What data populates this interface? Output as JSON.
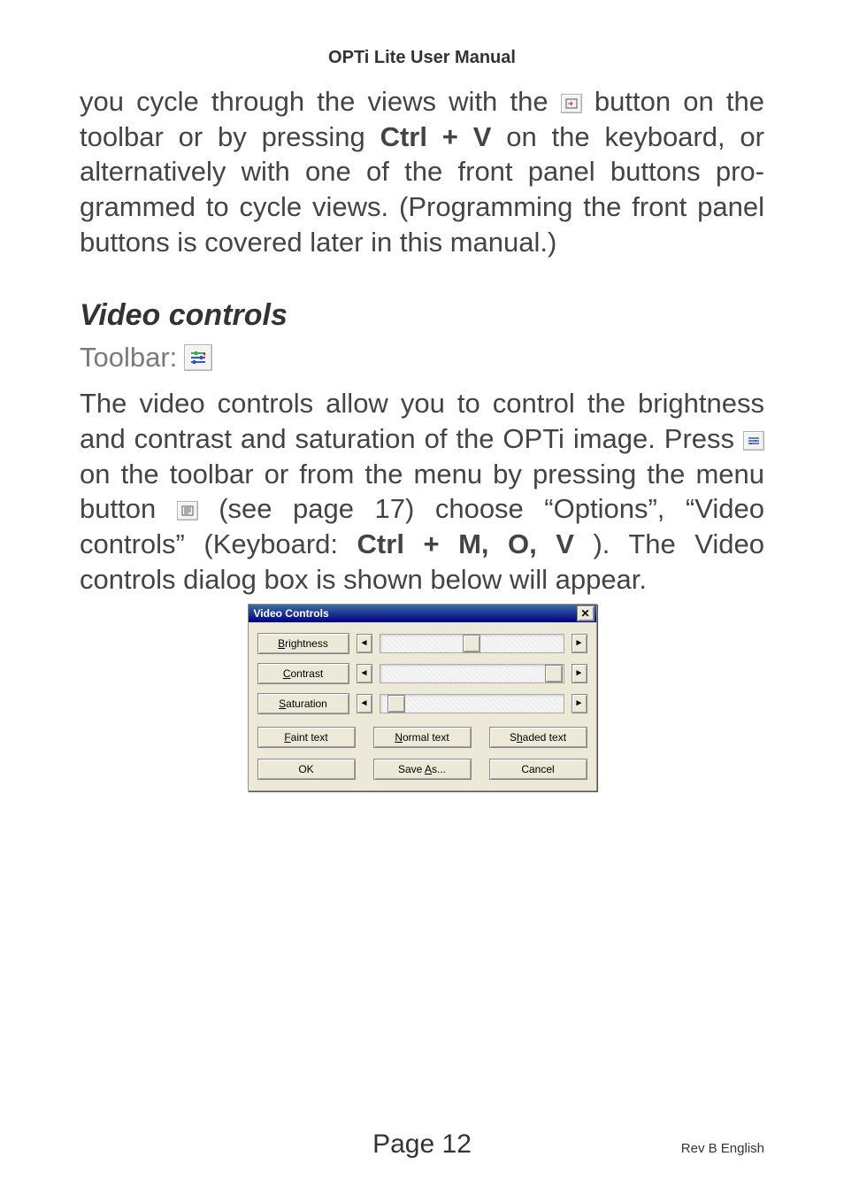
{
  "header": "OPTi Lite User Manual",
  "para1_pre": "you cycle through the views with the ",
  "para1_mid1": " button on the toolbar or by pressing ",
  "para1_kbd1": "Ctrl + V",
  "para1_post": " on the keyboard, or alternatively with one of the front panel buttons pro­grammed to cycle views. (Programming the front panel buttons is covered later in this manual.)",
  "section_title": "Video controls",
  "toolbar_label": "Toolbar:",
  "para2_a": "The video controls allow you to control the brightness and contrast and saturation of the OPTi image. Press ",
  "para2_b": " on the toolbar or from the menu by pressing the menu button ",
  "para2_c": " (see page 17) choose “Options”, “Video controls” (Keyboard: ",
  "para2_kbd": "Ctrl + M, O, V",
  "para2_d": "). The Video controls dialog box is shown below will appear.",
  "dialog": {
    "title": "Video Controls",
    "sliders": {
      "brightness": {
        "html": "<span class='ul'>B</span>rightness",
        "pos": 45
      },
      "contrast": {
        "html": "<span class='ul'>C</span>ontrast",
        "pos": 90
      },
      "saturation": {
        "html": "<span class='ul'>S</span>aturation",
        "pos": 4
      }
    },
    "presets": {
      "faint": "<span class='ul'>F</span>aint text",
      "normal": "<span class='ul'>N</span>ormal text",
      "shaded": "S<span class='ul'>h</span>aded text"
    },
    "actions": {
      "ok": "OK",
      "saveas": "Save <span class='ul'>A</span>s...",
      "cancel": "Cancel"
    }
  },
  "footer_page": "Page 12",
  "footer_rev": "Rev B English"
}
